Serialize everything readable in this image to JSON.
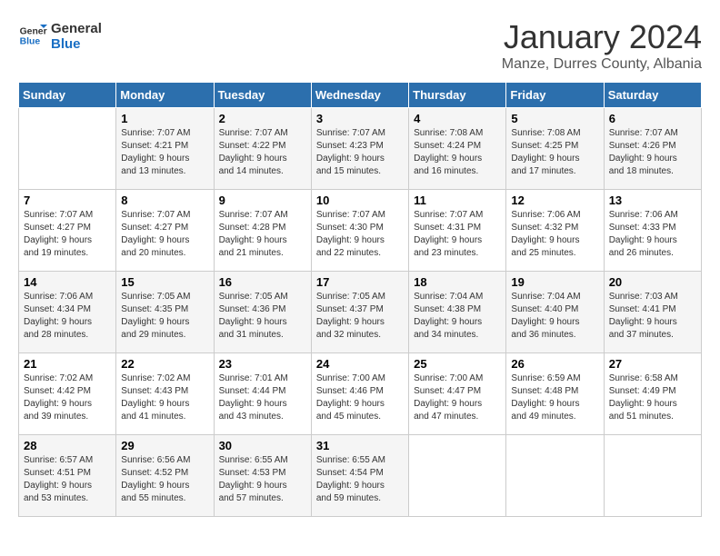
{
  "logo": {
    "line1": "General",
    "line2": "Blue"
  },
  "title": "January 2024",
  "subtitle": "Manze, Durres County, Albania",
  "days_header": [
    "Sunday",
    "Monday",
    "Tuesday",
    "Wednesday",
    "Thursday",
    "Friday",
    "Saturday"
  ],
  "weeks": [
    [
      {
        "num": "",
        "info": ""
      },
      {
        "num": "1",
        "info": "Sunrise: 7:07 AM\nSunset: 4:21 PM\nDaylight: 9 hours\nand 13 minutes."
      },
      {
        "num": "2",
        "info": "Sunrise: 7:07 AM\nSunset: 4:22 PM\nDaylight: 9 hours\nand 14 minutes."
      },
      {
        "num": "3",
        "info": "Sunrise: 7:07 AM\nSunset: 4:23 PM\nDaylight: 9 hours\nand 15 minutes."
      },
      {
        "num": "4",
        "info": "Sunrise: 7:08 AM\nSunset: 4:24 PM\nDaylight: 9 hours\nand 16 minutes."
      },
      {
        "num": "5",
        "info": "Sunrise: 7:08 AM\nSunset: 4:25 PM\nDaylight: 9 hours\nand 17 minutes."
      },
      {
        "num": "6",
        "info": "Sunrise: 7:07 AM\nSunset: 4:26 PM\nDaylight: 9 hours\nand 18 minutes."
      }
    ],
    [
      {
        "num": "7",
        "info": "Sunrise: 7:07 AM\nSunset: 4:27 PM\nDaylight: 9 hours\nand 19 minutes."
      },
      {
        "num": "8",
        "info": "Sunrise: 7:07 AM\nSunset: 4:27 PM\nDaylight: 9 hours\nand 20 minutes."
      },
      {
        "num": "9",
        "info": "Sunrise: 7:07 AM\nSunset: 4:28 PM\nDaylight: 9 hours\nand 21 minutes."
      },
      {
        "num": "10",
        "info": "Sunrise: 7:07 AM\nSunset: 4:30 PM\nDaylight: 9 hours\nand 22 minutes."
      },
      {
        "num": "11",
        "info": "Sunrise: 7:07 AM\nSunset: 4:31 PM\nDaylight: 9 hours\nand 23 minutes."
      },
      {
        "num": "12",
        "info": "Sunrise: 7:06 AM\nSunset: 4:32 PM\nDaylight: 9 hours\nand 25 minutes."
      },
      {
        "num": "13",
        "info": "Sunrise: 7:06 AM\nSunset: 4:33 PM\nDaylight: 9 hours\nand 26 minutes."
      }
    ],
    [
      {
        "num": "14",
        "info": "Sunrise: 7:06 AM\nSunset: 4:34 PM\nDaylight: 9 hours\nand 28 minutes."
      },
      {
        "num": "15",
        "info": "Sunrise: 7:05 AM\nSunset: 4:35 PM\nDaylight: 9 hours\nand 29 minutes."
      },
      {
        "num": "16",
        "info": "Sunrise: 7:05 AM\nSunset: 4:36 PM\nDaylight: 9 hours\nand 31 minutes."
      },
      {
        "num": "17",
        "info": "Sunrise: 7:05 AM\nSunset: 4:37 PM\nDaylight: 9 hours\nand 32 minutes."
      },
      {
        "num": "18",
        "info": "Sunrise: 7:04 AM\nSunset: 4:38 PM\nDaylight: 9 hours\nand 34 minutes."
      },
      {
        "num": "19",
        "info": "Sunrise: 7:04 AM\nSunset: 4:40 PM\nDaylight: 9 hours\nand 36 minutes."
      },
      {
        "num": "20",
        "info": "Sunrise: 7:03 AM\nSunset: 4:41 PM\nDaylight: 9 hours\nand 37 minutes."
      }
    ],
    [
      {
        "num": "21",
        "info": "Sunrise: 7:02 AM\nSunset: 4:42 PM\nDaylight: 9 hours\nand 39 minutes."
      },
      {
        "num": "22",
        "info": "Sunrise: 7:02 AM\nSunset: 4:43 PM\nDaylight: 9 hours\nand 41 minutes."
      },
      {
        "num": "23",
        "info": "Sunrise: 7:01 AM\nSunset: 4:44 PM\nDaylight: 9 hours\nand 43 minutes."
      },
      {
        "num": "24",
        "info": "Sunrise: 7:00 AM\nSunset: 4:46 PM\nDaylight: 9 hours\nand 45 minutes."
      },
      {
        "num": "25",
        "info": "Sunrise: 7:00 AM\nSunset: 4:47 PM\nDaylight: 9 hours\nand 47 minutes."
      },
      {
        "num": "26",
        "info": "Sunrise: 6:59 AM\nSunset: 4:48 PM\nDaylight: 9 hours\nand 49 minutes."
      },
      {
        "num": "27",
        "info": "Sunrise: 6:58 AM\nSunset: 4:49 PM\nDaylight: 9 hours\nand 51 minutes."
      }
    ],
    [
      {
        "num": "28",
        "info": "Sunrise: 6:57 AM\nSunset: 4:51 PM\nDaylight: 9 hours\nand 53 minutes."
      },
      {
        "num": "29",
        "info": "Sunrise: 6:56 AM\nSunset: 4:52 PM\nDaylight: 9 hours\nand 55 minutes."
      },
      {
        "num": "30",
        "info": "Sunrise: 6:55 AM\nSunset: 4:53 PM\nDaylight: 9 hours\nand 57 minutes."
      },
      {
        "num": "31",
        "info": "Sunrise: 6:55 AM\nSunset: 4:54 PM\nDaylight: 9 hours\nand 59 minutes."
      },
      {
        "num": "",
        "info": ""
      },
      {
        "num": "",
        "info": ""
      },
      {
        "num": "",
        "info": ""
      }
    ]
  ]
}
